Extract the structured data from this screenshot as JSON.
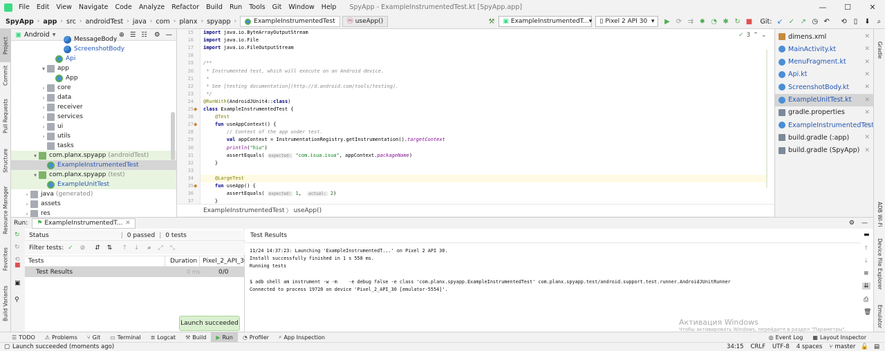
{
  "menubar": {
    "items": [
      "File",
      "Edit",
      "View",
      "Navigate",
      "Code",
      "Analyze",
      "Refactor",
      "Build",
      "Run",
      "Tools",
      "Git",
      "Window",
      "Help"
    ],
    "window_title": "SpyApp - ExampleInstrumentedTest.kt [SpyApp.app]"
  },
  "navbar": {
    "crumbs": [
      "SpyApp",
      "app",
      "src",
      "androidTest",
      "java",
      "com",
      "planx",
      "spyapp"
    ],
    "file_tab": "ExampleInstrumentedTest",
    "method_tab": "useApp()",
    "run_config": "ExampleInstrumentedT...",
    "device": "Pixel 2 API 30",
    "git_label": "Git:"
  },
  "left_strip": {
    "tabs": [
      "Project",
      "Commit",
      "Pull Requests",
      "Structure",
      "Resource Manager",
      "Favorites",
      "Build Variants"
    ]
  },
  "right_strip": {
    "tabs": [
      "Gradle",
      "ADB Wi-Fi",
      "Device File Explorer",
      "Emulator"
    ]
  },
  "project": {
    "view": "Android",
    "tree": [
      {
        "label": "MessageBody",
        "indent": 6,
        "icon": "kt",
        "arrow": ""
      },
      {
        "label": "ScreenshotBody",
        "indent": 6,
        "icon": "kt",
        "arrow": "",
        "color": "blue"
      },
      {
        "label": "Api",
        "indent": 5,
        "icon": "kt-green",
        "arrow": "",
        "color": "blue"
      },
      {
        "label": "app",
        "indent": 4,
        "icon": "folder",
        "arrow": "▾"
      },
      {
        "label": "App",
        "indent": 5,
        "icon": "kt-green",
        "arrow": ""
      },
      {
        "label": "core",
        "indent": 4,
        "icon": "folder",
        "arrow": "›"
      },
      {
        "label": "data",
        "indent": 4,
        "icon": "folder",
        "arrow": "›"
      },
      {
        "label": "receiver",
        "indent": 4,
        "icon": "folder",
        "arrow": "›"
      },
      {
        "label": "services",
        "indent": 4,
        "icon": "folder",
        "arrow": "›"
      },
      {
        "label": "ui",
        "indent": 4,
        "icon": "folder",
        "arrow": "›"
      },
      {
        "label": "utils",
        "indent": 4,
        "icon": "folder",
        "arrow": "›"
      },
      {
        "label": "tasks",
        "indent": 4,
        "icon": "folder",
        "arrow": ""
      },
      {
        "label": "com.planx.spyapp",
        "suffix": "(androidTest)",
        "indent": 3,
        "icon": "folder-green",
        "arrow": "▾",
        "hl": "green"
      },
      {
        "label": "ExampleInstrumentedTest",
        "indent": 4,
        "icon": "kt-green",
        "arrow": "",
        "color": "blue",
        "hl": "grey"
      },
      {
        "label": "com.planx.spyapp",
        "suffix": "(test)",
        "indent": 3,
        "icon": "folder-green",
        "arrow": "▾",
        "hl": "green"
      },
      {
        "label": "ExampleUnitTest",
        "indent": 4,
        "icon": "kt-green",
        "arrow": "",
        "color": "blue",
        "hl": "green"
      },
      {
        "label": "java",
        "suffix": "(generated)",
        "indent": 2,
        "icon": "folder",
        "arrow": "›"
      },
      {
        "label": "assets",
        "indent": 2,
        "icon": "folder",
        "arrow": "›"
      },
      {
        "label": "res",
        "indent": 2,
        "icon": "folder",
        "arrow": "›"
      }
    ]
  },
  "editor": {
    "warnings": "3",
    "lines": [
      {
        "n": "15",
        "html": "<span class='kw'>import</span> java.io.ByteArrayOutputStream"
      },
      {
        "n": "16",
        "html": "<span class='kw'>import</span> java.io.File"
      },
      {
        "n": "17",
        "html": "<span class='kw'>import</span> java.io.FileOutputStream"
      },
      {
        "n": "18",
        "html": ""
      },
      {
        "n": "19",
        "html": "<span class='cm'>/**</span>"
      },
      {
        "n": "20",
        "html": "<span class='cm'> * Instrumented test, which will execute on an Android device.</span>"
      },
      {
        "n": "21",
        "html": "<span class='cm'> *</span>"
      },
      {
        "n": "22",
        "html": "<span class='cm'> * See [testing documentation](http://d.android.com/tools/testing).</span>"
      },
      {
        "n": "23",
        "html": "<span class='cm'> */</span>"
      },
      {
        "n": "24",
        "html": "<span class='an'>@RunWith</span>(AndroidJUnit4::<span class='kw'>class</span>)"
      },
      {
        "n": "25",
        "html": "<span class='kw'>class</span> ExampleInstrumentedTest {",
        "mark": true
      },
      {
        "n": "26",
        "html": "    <span class='an'>@Test</span>"
      },
      {
        "n": "27",
        "html": "    <span class='kw'>fun</span> useAppContext() {",
        "mark": true
      },
      {
        "n": "28",
        "html": "        <span class='cm'>// Context of the app under test.</span>"
      },
      {
        "n": "29",
        "html": "        <span class='kw'>val</span> appContext = InstrumentationRegistry.getInstrumentation().<span class='it'>targetContext</span>"
      },
      {
        "n": "30",
        "html": "        <span class='it'>println</span>(<span class='st'>\"hiu\"</span>)"
      },
      {
        "n": "31",
        "html": "        assertEquals( <span class='hint'>expected:</span> <span class='st'>\"com.isua.isua\"</span>, appContext.<span class='it'>packageName</span>)"
      },
      {
        "n": "32",
        "html": "    }"
      },
      {
        "n": "33",
        "html": ""
      },
      {
        "n": "34",
        "html": "    <span class='an'>@LargeTest</span>",
        "current": true
      },
      {
        "n": "35",
        "html": "    <span class='kw'>fun</span> useApp() {",
        "mark": true
      },
      {
        "n": "36",
        "html": "        assertEquals( <span class='hint'>expected:</span> <span class='st'>1</span>,  <span class='hint'>actual:</span> <span class='st'>2</span>)"
      },
      {
        "n": "37",
        "html": "    }"
      }
    ],
    "footer": {
      "cls": "ExampleInstrumentedTest",
      "method": "useApp()"
    }
  },
  "recent_files": [
    {
      "name": "dimens.xml",
      "icon": "xml"
    },
    {
      "name": "MainActivity.kt",
      "icon": "kt"
    },
    {
      "name": "MenuFragment.kt",
      "icon": "kt"
    },
    {
      "name": "Api.kt",
      "icon": "kt"
    },
    {
      "name": "ScreenshotBody.kt",
      "icon": "kt"
    },
    {
      "name": "ExampleUnitTest.kt",
      "icon": "kt",
      "active": true
    },
    {
      "name": "gradle.properties",
      "icon": "gradle"
    },
    {
      "name": "ExampleInstrumentedTest.kt",
      "icon": "kt"
    },
    {
      "name": "build.gradle (:app)",
      "icon": "gradle"
    },
    {
      "name": "build.gradle (SpyApp)",
      "icon": "gradle"
    }
  ],
  "run": {
    "label": "Run:",
    "tab": "ExampleInstrumentedT...",
    "status_label": "Status",
    "passed": "0 passed",
    "tests_count": "0 tests",
    "filter_label": "Filter tests:",
    "columns": [
      "Tests",
      "Duration",
      "Pixel_2_API_30"
    ],
    "result_row": {
      "name": "Test Results",
      "duration": "0 ms",
      "device": "0/0"
    },
    "console_title": "Test Results",
    "console_lines": [
      "11/24 14:37:23: Launching 'ExampleInstrumentedT...' on Pixel 2 API 30.",
      "Install successfully finished in 1 s 558 ms.",
      "Running tests",
      "",
      "$ adb shell am instrument -w -m    -e debug false -e class 'com.planx.spyapp.ExampleInstrumentedTest' com.planx.spyapp.test/android.support.test.runner.AndroidJUnitRunner",
      "Connected to process 19720 on device 'Pixel_2_API_30 [emulator-5554]'."
    ]
  },
  "toast": "Launch succeeded",
  "watermark": {
    "title": "Активация Windows",
    "sub": "Чтобы активировать Windows, перейдите в раздел \"Параметры\"."
  },
  "bottom_tabs": [
    "TODO",
    "Problems",
    "Git",
    "Terminal",
    "Logcat",
    "Build",
    "Run",
    "Profiler",
    "App Inspection"
  ],
  "bottom_right_tabs": [
    "Event Log",
    "Layout Inspector"
  ],
  "status": {
    "message": "Launch succeeded (moments ago)",
    "position": "34:15",
    "line_sep": "CRLF",
    "encoding": "UTF-8",
    "indent": "4 spaces",
    "branch": "master"
  }
}
